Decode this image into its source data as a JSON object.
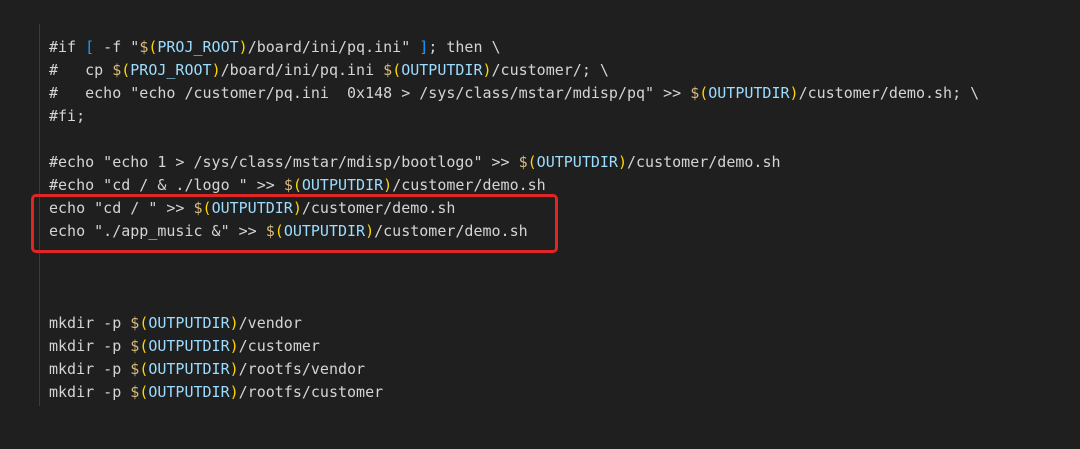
{
  "lines": [
    {
      "id": 1,
      "segments": [
        {
          "t": "#if ",
          "c": "plain"
        },
        {
          "t": "[",
          "c": "bracket"
        },
        {
          "t": " -f \"",
          "c": "plain"
        },
        {
          "t": "$",
          "c": "dollar"
        },
        {
          "t": "(",
          "c": "paren-yellow"
        },
        {
          "t": "PROJ_ROOT",
          "c": "var"
        },
        {
          "t": ")",
          "c": "paren-yellow"
        },
        {
          "t": "/board/ini/pq.ini\" ",
          "c": "plain"
        },
        {
          "t": "]",
          "c": "bracket"
        },
        {
          "t": "; then \\",
          "c": "plain"
        }
      ]
    },
    {
      "id": 2,
      "segments": [
        {
          "t": "#   cp ",
          "c": "plain"
        },
        {
          "t": "$",
          "c": "dollar"
        },
        {
          "t": "(",
          "c": "paren-yellow"
        },
        {
          "t": "PROJ_ROOT",
          "c": "var"
        },
        {
          "t": ")",
          "c": "paren-yellow"
        },
        {
          "t": "/board/ini/pq.ini ",
          "c": "plain"
        },
        {
          "t": "$",
          "c": "dollar"
        },
        {
          "t": "(",
          "c": "paren-yellow"
        },
        {
          "t": "OUTPUTDIR",
          "c": "var"
        },
        {
          "t": ")",
          "c": "paren-yellow"
        },
        {
          "t": "/customer/; \\",
          "c": "plain"
        }
      ]
    },
    {
      "id": 3,
      "segments": [
        {
          "t": "#   echo \"echo /customer/pq.ini  0x148 > /sys/class/mstar/mdisp/pq\" >> ",
          "c": "plain"
        },
        {
          "t": "$",
          "c": "dollar"
        },
        {
          "t": "(",
          "c": "paren-yellow"
        },
        {
          "t": "OUTPUTDIR",
          "c": "var"
        },
        {
          "t": ")",
          "c": "paren-yellow"
        },
        {
          "t": "/customer/demo.sh; \\",
          "c": "plain"
        }
      ]
    },
    {
      "id": 4,
      "segments": [
        {
          "t": "#fi;",
          "c": "plain"
        }
      ]
    },
    {
      "id": 5,
      "segments": []
    },
    {
      "id": 6,
      "segments": [
        {
          "t": "#echo \"echo 1 > /sys/class/mstar/mdisp/bootlogo\" >> ",
          "c": "plain"
        },
        {
          "t": "$",
          "c": "dollar"
        },
        {
          "t": "(",
          "c": "paren-yellow"
        },
        {
          "t": "OUTPUTDIR",
          "c": "var"
        },
        {
          "t": ")",
          "c": "paren-yellow"
        },
        {
          "t": "/customer/demo.sh",
          "c": "plain"
        }
      ]
    },
    {
      "id": 7,
      "segments": [
        {
          "t": "#echo \"cd / & ./logo \" >> ",
          "c": "plain"
        },
        {
          "t": "$",
          "c": "dollar"
        },
        {
          "t": "(",
          "c": "paren-yellow"
        },
        {
          "t": "OUTPUTDIR",
          "c": "var"
        },
        {
          "t": ")",
          "c": "paren-yellow"
        },
        {
          "t": "/customer/demo.sh",
          "c": "plain"
        }
      ]
    },
    {
      "id": 8,
      "segments": [
        {
          "t": "echo \"cd / \" >> ",
          "c": "plain"
        },
        {
          "t": "$",
          "c": "dollar"
        },
        {
          "t": "(",
          "c": "paren-yellow"
        },
        {
          "t": "OUTPUTDIR",
          "c": "var"
        },
        {
          "t": ")",
          "c": "paren-yellow"
        },
        {
          "t": "/customer/demo.sh",
          "c": "plain"
        }
      ]
    },
    {
      "id": 9,
      "segments": [
        {
          "t": "echo \"./app_music &\" >> ",
          "c": "plain"
        },
        {
          "t": "$",
          "c": "dollar"
        },
        {
          "t": "(",
          "c": "paren-yellow"
        },
        {
          "t": "OUTPUTDIR",
          "c": "var"
        },
        {
          "t": ")",
          "c": "paren-yellow"
        },
        {
          "t": "/customer/demo.sh",
          "c": "plain"
        }
      ]
    },
    {
      "id": 10,
      "segments": []
    },
    {
      "id": 11,
      "segments": []
    },
    {
      "id": 12,
      "segments": []
    },
    {
      "id": 13,
      "segments": [
        {
          "t": "mkdir -p ",
          "c": "plain"
        },
        {
          "t": "$",
          "c": "dollar"
        },
        {
          "t": "(",
          "c": "paren-yellow"
        },
        {
          "t": "OUTPUTDIR",
          "c": "var"
        },
        {
          "t": ")",
          "c": "paren-yellow"
        },
        {
          "t": "/vendor",
          "c": "plain"
        }
      ]
    },
    {
      "id": 14,
      "segments": [
        {
          "t": "mkdir -p ",
          "c": "plain"
        },
        {
          "t": "$",
          "c": "dollar"
        },
        {
          "t": "(",
          "c": "paren-yellow"
        },
        {
          "t": "OUTPUTDIR",
          "c": "var"
        },
        {
          "t": ")",
          "c": "paren-yellow"
        },
        {
          "t": "/customer",
          "c": "plain"
        }
      ]
    },
    {
      "id": 15,
      "segments": [
        {
          "t": "mkdir -p ",
          "c": "plain"
        },
        {
          "t": "$",
          "c": "dollar"
        },
        {
          "t": "(",
          "c": "paren-yellow"
        },
        {
          "t": "OUTPUTDIR",
          "c": "var"
        },
        {
          "t": ")",
          "c": "paren-yellow"
        },
        {
          "t": "/rootfs/vendor",
          "c": "plain"
        }
      ]
    },
    {
      "id": 16,
      "segments": [
        {
          "t": "mkdir -p ",
          "c": "plain"
        },
        {
          "t": "$",
          "c": "dollar"
        },
        {
          "t": "(",
          "c": "paren-yellow"
        },
        {
          "t": "OUTPUTDIR",
          "c": "var"
        },
        {
          "t": ")",
          "c": "paren-yellow"
        },
        {
          "t": "/rootfs/customer",
          "c": "plain"
        }
      ]
    }
  ],
  "colors": {
    "background": "#1f1f1f",
    "text": "#d4d4d4",
    "dollar": "#d7ba7d",
    "paren": "#ffd700",
    "variable": "#9cdcfe",
    "bracket": "#179fff",
    "highlight_border": "#e02525"
  },
  "highlight": {
    "label": "highlighted-lines",
    "lines": [
      8,
      9
    ]
  }
}
